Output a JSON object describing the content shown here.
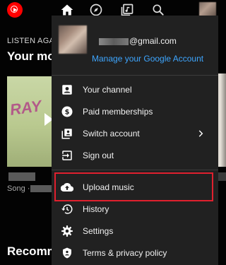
{
  "background": {
    "section_label": "LISTEN AGAI",
    "section_title": "Your mor",
    "album_art_text": "RAY",
    "song_caption": "Song ·",
    "bottom_title": "Recomm"
  },
  "account_menu": {
    "email_suffix": "@gmail.com",
    "manage_link": "Manage your Google Account",
    "items": [
      {
        "label": "Your channel",
        "icon": "person-box-icon"
      },
      {
        "label": "Paid memberships",
        "icon": "dollar-circle-icon"
      },
      {
        "label": "Switch account",
        "icon": "switch-account-icon"
      },
      {
        "label": "Sign out",
        "icon": "sign-out-icon"
      },
      {
        "label": "Upload music",
        "icon": "cloud-upload-icon",
        "highlighted": true
      },
      {
        "label": "History",
        "icon": "history-icon"
      },
      {
        "label": "Settings",
        "icon": "gear-icon"
      },
      {
        "label": "Terms & privacy policy",
        "icon": "shield-icon"
      }
    ]
  },
  "colors": {
    "background": "#030303",
    "menu": "#212121",
    "link": "#3ea6ff",
    "highlight_border": "#e0202e",
    "brand": "#ff0000"
  }
}
